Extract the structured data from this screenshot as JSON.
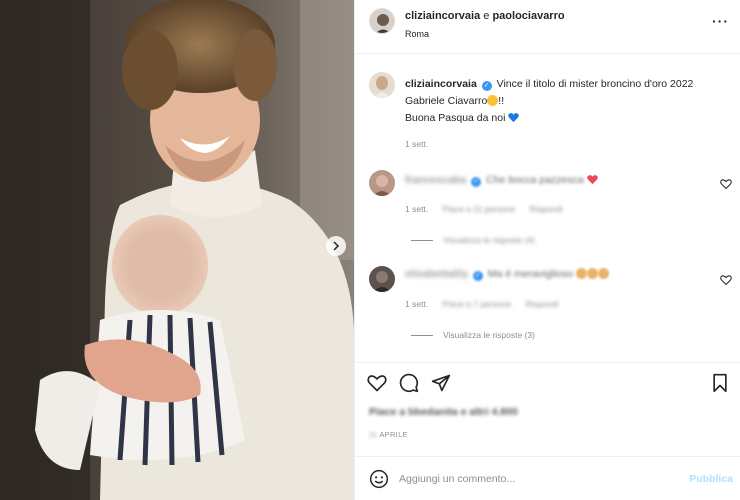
{
  "post": {
    "header": {
      "user1": "cliziaincorvaia",
      "joiner": " e ",
      "user2": "paolociavarro",
      "location": "Roma"
    },
    "caption": {
      "username": "cliziaincorvaia",
      "line1": "Vince il titolo di mister broncino d'oro 2022",
      "line2": "Gabriele Ciavarro",
      "line2_end": "!!",
      "line3": "Buona Pasqua da noi",
      "time": "1 sett."
    },
    "comments": [
      {
        "username": "francescaba",
        "text": "Che bocca pazzesca",
        "time": "1 sett.",
        "likes": "Piace a 11 persone",
        "reply": "Rispondi",
        "view_replies": "Visualizza le risposte (4)"
      },
      {
        "username": "elisabettalily",
        "text": "Ma è meraviglioso",
        "time": "1 sett.",
        "likes": "Piace a 7 persone",
        "reply": "Rispondi",
        "view_replies": "Visualizza le risposte (3)"
      }
    ],
    "likes_text": "Piace a bbedanita e altri 4.800",
    "date_prefix": "11",
    "date_suffix": " APRILE",
    "add_comment_placeholder": "Aggiungi un commento...",
    "publish_label": "Pubblica"
  },
  "colors": {
    "accent": "#3897f0",
    "publish_disabled": "#b2dffc",
    "heart_emoji": "#ed4956",
    "blue_heart": "#1f7ae0",
    "secondary_text": "#8e8e8e"
  },
  "icons": [
    "more-icon",
    "verified-icon",
    "heart-icon",
    "comment-icon",
    "share-icon",
    "save-icon",
    "emoji-icon",
    "chevron-right-icon"
  ]
}
